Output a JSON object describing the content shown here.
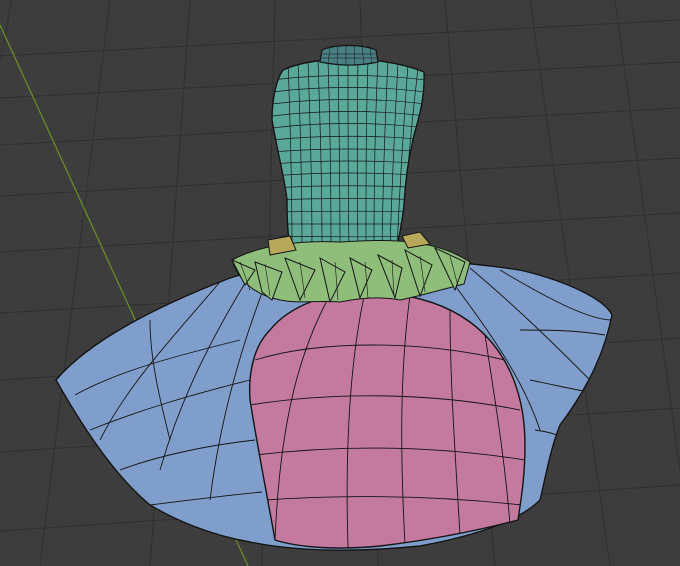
{
  "viewport": {
    "background": "#3d3d3d",
    "grid_color": "#303030",
    "axis_color": "#6b8a2a"
  },
  "model": {
    "wire_color": "#141414",
    "parts": [
      {
        "name": "bodice",
        "color": "#5aa89a"
      },
      {
        "name": "collar",
        "color": "#4a7f84"
      },
      {
        "name": "ruffle",
        "color": "#8fbe7b"
      },
      {
        "name": "outer-skirt",
        "color": "#7f9ecb"
      },
      {
        "name": "inner-skirt",
        "color": "#c47a9e"
      }
    ]
  }
}
